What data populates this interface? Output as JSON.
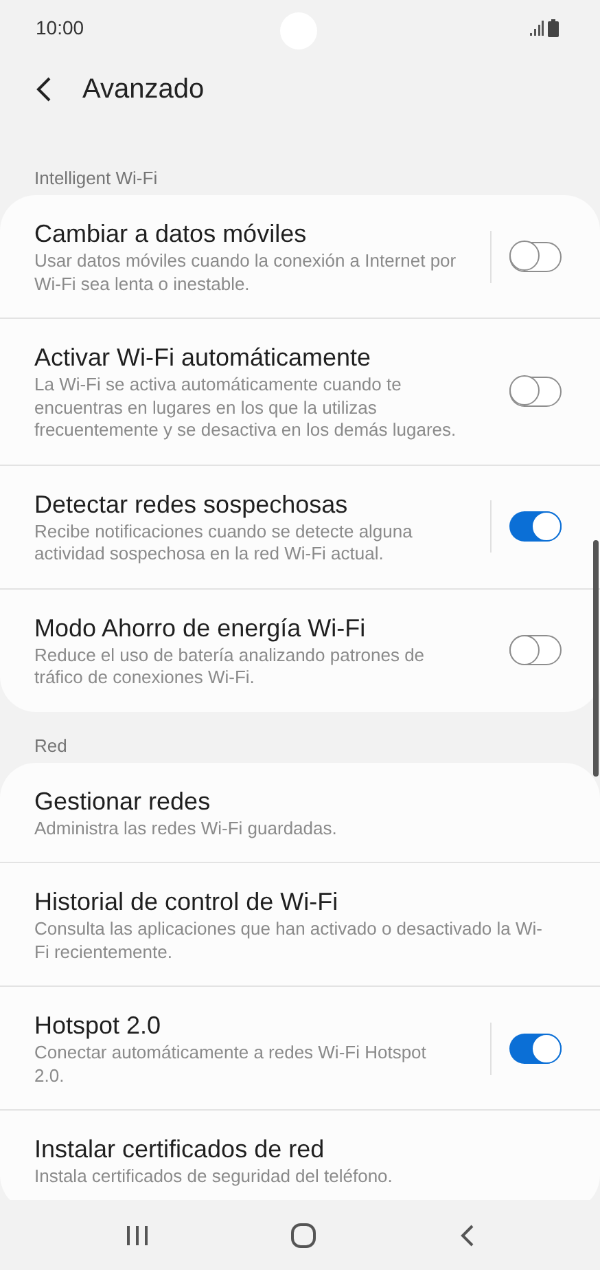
{
  "status_bar": {
    "time": "10:00"
  },
  "header": {
    "title": "Avanzado"
  },
  "sections": [
    {
      "label": "Intelligent Wi-Fi",
      "items": [
        {
          "kind": "split-toggle",
          "title": "Cambiar a datos móviles",
          "description": "Usar datos móviles cuando la conexión a Internet por Wi-Fi sea lenta o inestable.",
          "on": false
        },
        {
          "kind": "toggle",
          "title": "Activar Wi-Fi automáticamente",
          "description": "La Wi-Fi se activa automáticamente cuando te encuentras en lugares en los que la utilizas frecuentemente y se desactiva en los demás lugares.",
          "on": false
        },
        {
          "kind": "split-toggle",
          "title": "Detectar redes sospechosas",
          "description": "Recibe notificaciones cuando se detecte alguna actividad sospechosa en la red Wi-Fi actual.",
          "on": true
        },
        {
          "kind": "toggle",
          "title": "Modo Ahorro de energía Wi-Fi",
          "description": "Reduce el uso de batería analizando patrones de tráfico de conexiones Wi-Fi.",
          "on": false
        }
      ]
    },
    {
      "label": "Red",
      "items": [
        {
          "kind": "link",
          "title": "Gestionar redes",
          "description": "Administra las redes Wi-Fi guardadas."
        },
        {
          "kind": "link",
          "title": "Historial de control de Wi-Fi",
          "description": "Consulta las aplicaciones que han activado o desactivado la Wi-Fi recientemente."
        },
        {
          "kind": "split-toggle",
          "title": "Hotspot 2.0",
          "description": "Conectar automáticamente a redes Wi-Fi Hotspot 2.0.",
          "on": true
        },
        {
          "kind": "link",
          "title": "Instalar certificados de red",
          "description": "Instala certificados de seguridad del teléfono."
        }
      ]
    }
  ]
}
